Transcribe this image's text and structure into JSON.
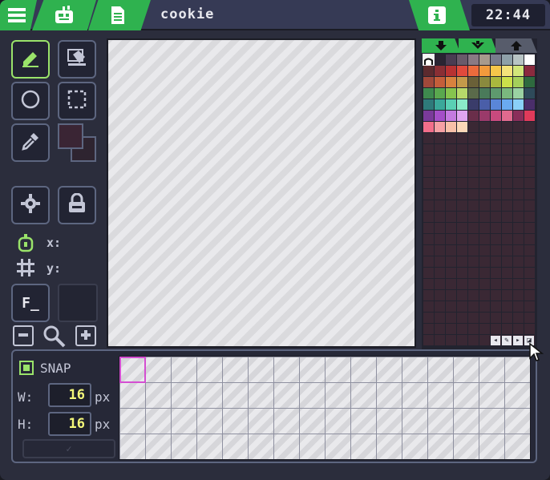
{
  "app": {
    "title": "cookie",
    "clock": "22:44"
  },
  "header": {
    "tabs": [
      {
        "icon": "hamburger-menu-icon"
      },
      {
        "icon": "sprite-editor-icon"
      },
      {
        "icon": "code-file-icon"
      },
      {
        "icon": "info-icon"
      }
    ]
  },
  "tools": {
    "coord_x_label": "x:",
    "coord_y_label": "y:",
    "font_button_label": "F_"
  },
  "palette": {
    "colors": [
      "#f4f4f4",
      "#2a2432",
      "#4a3c52",
      "#6a5a6a",
      "#8a7a84",
      "#a89a8c",
      "#787c8c",
      "#8ea0a8",
      "#b8c4c4",
      "#ffffff",
      "#5c2a2e",
      "#8a2e34",
      "#b83232",
      "#e04a3c",
      "#ec6b3c",
      "#f29a3c",
      "#f6c64a",
      "#f4e27a",
      "#d2e67a",
      "#8a2a3e",
      "#a0483a",
      "#c45e3a",
      "#d8823e",
      "#c49a4a",
      "#6a6038",
      "#8a8a3e",
      "#aab83e",
      "#cce04a",
      "#a4d05a",
      "#2e6a3e",
      "#3e8a4e",
      "#5aa84e",
      "#86c44e",
      "#b6d86a",
      "#5a6a4a",
      "#4a7a5a",
      "#5e9a6e",
      "#7ab87e",
      "#9ad2a2",
      "#2e4a5a",
      "#2e7a7a",
      "#3aa89a",
      "#5ad0b4",
      "#8aeac8",
      "#3a3c6a",
      "#4a5ea8",
      "#5a86d8",
      "#6aaaf0",
      "#8ad0f8",
      "#4a2e6a",
      "#7a3a9a",
      "#a44ec8",
      "#c47ae0",
      "#e0a4f0",
      "#6a2e4a",
      "#9a3a6a",
      "#c84a7e",
      "#e06a8e",
      "#8a2e5a",
      "#e03a5a",
      "#f26e8a",
      "#f6a0a4",
      "#f8c0a8",
      "#fcd8b8"
    ],
    "empty_slots": 256
  },
  "sheet": {
    "snap_label": "SNAP",
    "width_label": "W:",
    "height_label": "H:",
    "width_value": "16",
    "height_value": "16",
    "unit": "px",
    "apply_label": "✓"
  }
}
